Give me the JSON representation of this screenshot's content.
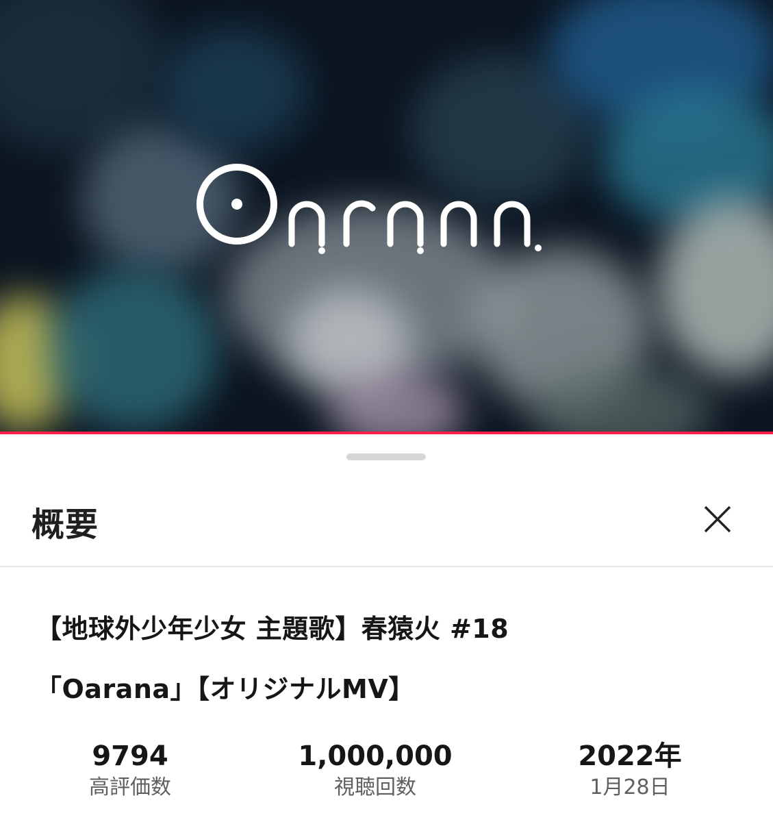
{
  "video": {
    "logo_text": "Oarana",
    "progress_color": "#ff1f4a"
  },
  "description_panel": {
    "title": "概要",
    "close_icon": "close-icon",
    "video_title_line1": "【地球外少年少女 主題歌】春猿火 #18",
    "video_title_line2": "「Oarana」【オリジナルMV】",
    "stats": [
      {
        "value": "9794",
        "label": "高評価数"
      },
      {
        "value": "1,000,000",
        "label": "視聴回数"
      },
      {
        "value": "2022年",
        "label": "1月28日"
      }
    ]
  }
}
